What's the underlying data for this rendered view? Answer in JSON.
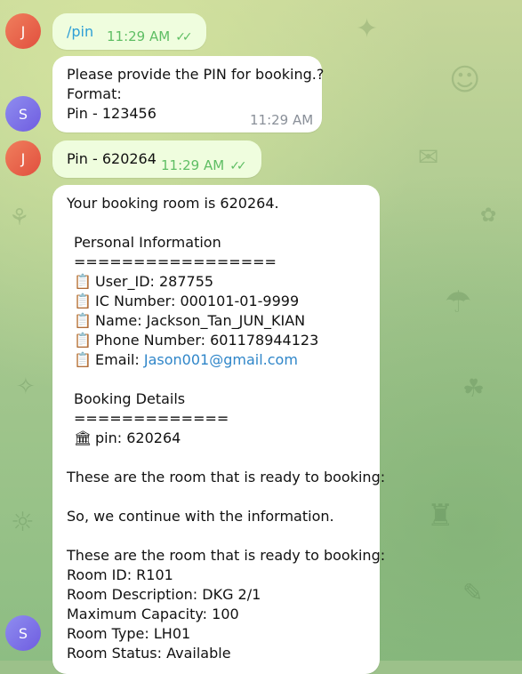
{
  "avatars": {
    "j": "J",
    "s": "S"
  },
  "messages": {
    "pin_command": {
      "text": "/pin",
      "time": "11:29 AM",
      "checks": "✓✓"
    },
    "pin_prompt": {
      "lines": [
        "Please provide the PIN for booking.?",
        "Format:",
        "Pin - 123456"
      ],
      "time": "11:29 AM"
    },
    "pin_reply": {
      "text": "Pin - 620264",
      "time": "11:29 AM",
      "checks": "✓✓"
    },
    "booking_details": {
      "line_1": "Your booking room is 620264.",
      "personal_title": "Personal Information",
      "personal_rule": "=================",
      "personal": {
        "user_id": "User_ID: 287755",
        "ic_number": "IC Number: 000101-01-9999",
        "name": "Name: Jackson_Tan_JUN_KIAN",
        "phone": "Phone Number: 601178944123",
        "email_prefix": "Email: ",
        "email": "Jason001@gmail.com"
      },
      "booking_title": "Booking Details",
      "booking_rule": "=============",
      "booking": {
        "pin": "pin: 620264"
      },
      "ready_1": "These are the room that is ready to booking:",
      "continue_line": "So, we continue with the information.",
      "ready_2": "These are the room that is ready to booking:",
      "room_id": " Room ID:  R101",
      "room_description": "Room Description: DKG 2/1",
      "maximum_capacity": "Maximum Capacity: 100",
      "room_type": "Room Type: LH01",
      "room_status": "Room Status: Available"
    }
  },
  "icons": {
    "clipboard_icon": "📋",
    "bank_icon": "🏛"
  },
  "colors": {
    "outgoing_bubble": "#effdde",
    "incoming_bubble": "#ffffff",
    "time_green": "#5fbe64",
    "link_blue": "#2f86c9"
  }
}
